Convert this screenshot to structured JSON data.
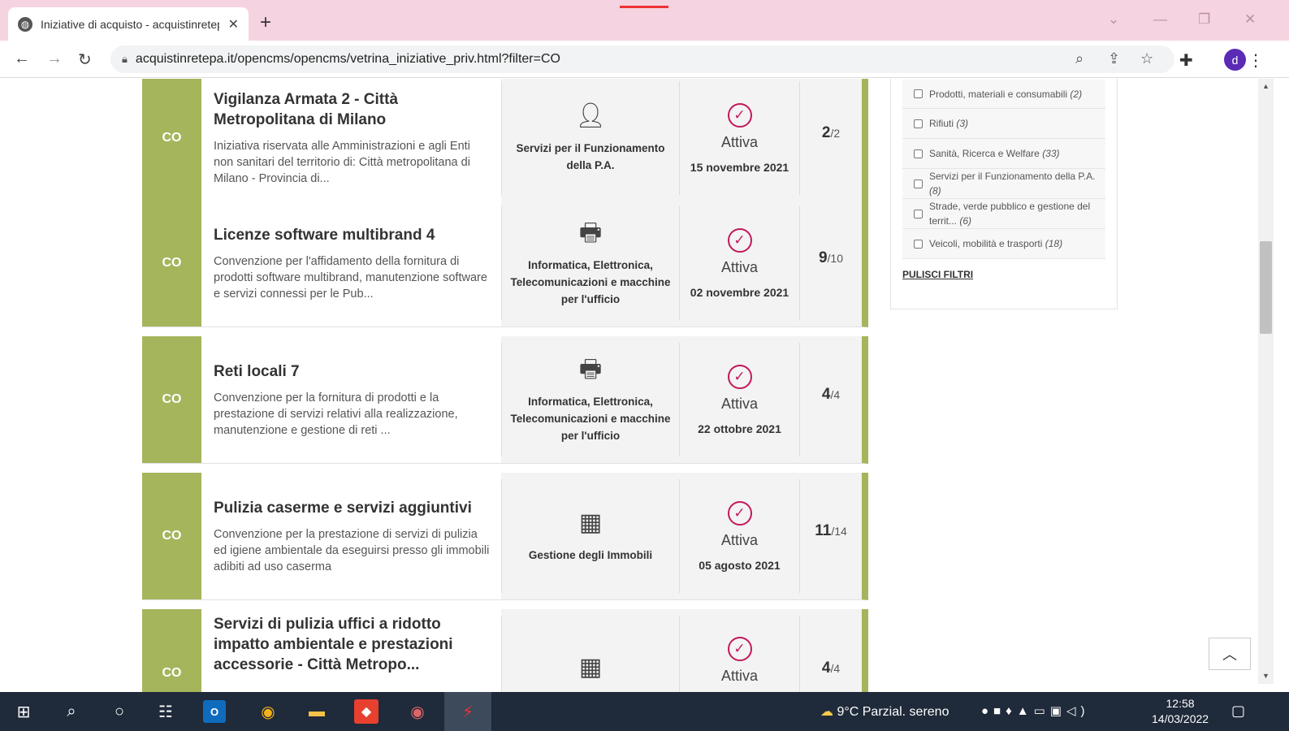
{
  "browser": {
    "tab_title": "Iniziative di acquisto - acquistinretepa.it",
    "new_tab": "+",
    "url": "acquistinretepa.it/opencms/opencms/vetrina_iniziative_priv.html?filter=CO",
    "profile_letter": "d"
  },
  "cards": [
    {
      "code": "CO",
      "title": "Vigilanza Armata 2 - Città Metropolitana di Milano",
      "description": "Iniziativa riservata alle Amministrazioni e agli Enti non sanitari del territorio di: Città metropolitana di Milano - Provincia di...",
      "category": "Servizi per il Funzionamento della P.A.",
      "category_icon": "person-badge-icon",
      "status": "Attiva",
      "date": "15 novembre 2021",
      "count": "2",
      "total": "/2"
    },
    {
      "code": "CO",
      "title": "Licenze software multibrand 4",
      "description": "Convenzione per l'affidamento della fornitura di prodotti software multibrand, manutenzione software e servizi connessi per le Pub...",
      "category": "Informatica, Elettronica, Telecomunicazioni e macchine per l'ufficio",
      "category_icon": "printer-icon",
      "status": "Attiva",
      "date": "02 novembre 2021",
      "count": "9",
      "total": "/10"
    },
    {
      "code": "CO",
      "title": "Reti locali 7",
      "description": "Convenzione per la fornitura di prodotti e la prestazione di servizi relativi alla realizzazione, manutenzione e gestione di reti ...",
      "category": "Informatica, Elettronica, Telecomunicazioni e macchine per l'ufficio",
      "category_icon": "printer-icon",
      "status": "Attiva",
      "date": "22 ottobre 2021",
      "count": "4",
      "total": "/4"
    },
    {
      "code": "CO",
      "title": "Pulizia caserme e servizi aggiuntivi",
      "description": "Convenzione per la prestazione di servizi di pulizia ed igiene ambientale da eseguirsi presso gli immobili adibiti ad uso caserma",
      "category": "Gestione degli Immobili",
      "category_icon": "building-icon",
      "status": "Attiva",
      "date": "05 agosto 2021",
      "count": "11",
      "total": "/14"
    },
    {
      "code": "CO",
      "title": "Servizi di pulizia uffici a ridotto impatto ambientale e prestazioni accessorie - Città Metropo...",
      "description": "",
      "category": "",
      "category_icon": "building-icon",
      "status": "Attiva",
      "date": "",
      "count": "4",
      "total": "/4"
    }
  ],
  "filters": {
    "items": [
      {
        "label": "Prodotti, materiali e consumabili",
        "count": "(2)"
      },
      {
        "label": "Rifiuti",
        "count": "(3)"
      },
      {
        "label": "Sanità, Ricerca e Welfare",
        "count": "(33)"
      },
      {
        "label": "Servizi per il Funzionamento della P.A.",
        "count": "(8)"
      },
      {
        "label": "Strade, verde pubblico e gestione del territ...",
        "count": "(6)"
      },
      {
        "label": "Veicoli, mobilità e trasporti",
        "count": "(18)"
      }
    ],
    "clear_label": "PULISCI FILTRI"
  },
  "taskbar": {
    "weather": "9°C  Parzial. sereno",
    "time": "12:58",
    "date": "14/03/2022"
  },
  "colors": {
    "accent_green": "#a5b55c",
    "check_magenta": "#c2185b",
    "titlebar_pink": "#f6d3e0"
  }
}
